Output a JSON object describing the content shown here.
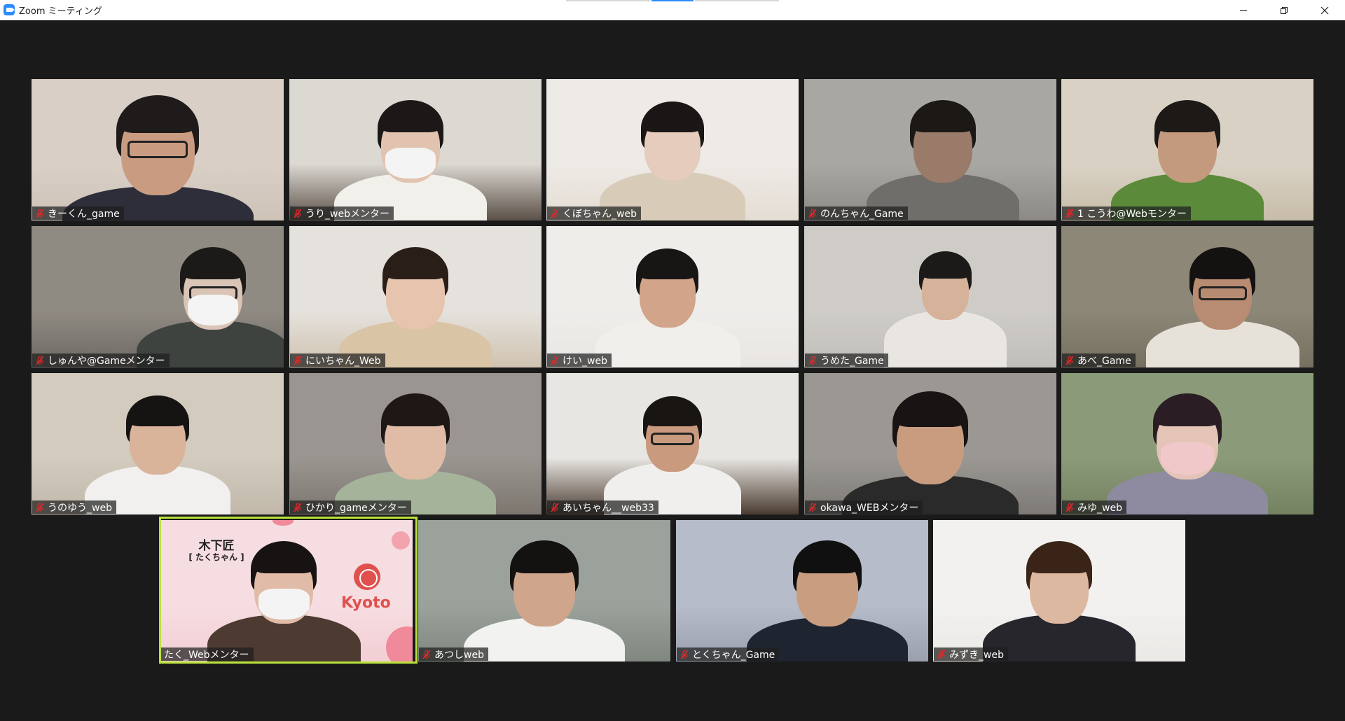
{
  "window": {
    "title": "Zoom ミーティング",
    "controls": [
      "minimize-icon",
      "restore-icon",
      "close-icon"
    ]
  },
  "participants": [
    {
      "name": "きーくん_game",
      "muted": true
    },
    {
      "name": "うり_webメンター",
      "muted": true
    },
    {
      "name": "くぼちゃん_web",
      "muted": true
    },
    {
      "name": "のんちゃん_Game",
      "muted": true
    },
    {
      "name": "1 こうわ@Webモンター",
      "muted": true
    },
    {
      "name": "しゅんや@Gameメンター",
      "muted": true
    },
    {
      "name": "にいちゃん_Web",
      "muted": true
    },
    {
      "name": "けい_web",
      "muted": true
    },
    {
      "name": "うめた_Game",
      "muted": true
    },
    {
      "name": "あべ_Game",
      "muted": true
    },
    {
      "name": "うのゆう_web",
      "muted": true
    },
    {
      "name": "ひかり_gameメンター",
      "muted": true
    },
    {
      "name": "あいちゃん__web33",
      "muted": true
    },
    {
      "name": "okawa_WEBメンター",
      "muted": true
    },
    {
      "name": "みゆ_web",
      "muted": true
    },
    {
      "name": "たく_Webメンター",
      "muted": false,
      "active_speaker": true
    },
    {
      "name": "あつしweb",
      "muted": true
    },
    {
      "name": "とくちゃん_Game",
      "muted": true
    },
    {
      "name": "みずき_web",
      "muted": true
    }
  ],
  "overlay": {
    "full_name": "木下匠",
    "nickname": "[ たくちゃん ]",
    "logo_text": "Kyoto"
  },
  "colors": {
    "background": "#1a1a1a",
    "active_speaker_border": "#b9e33a",
    "mic_muted": "#e02828"
  }
}
